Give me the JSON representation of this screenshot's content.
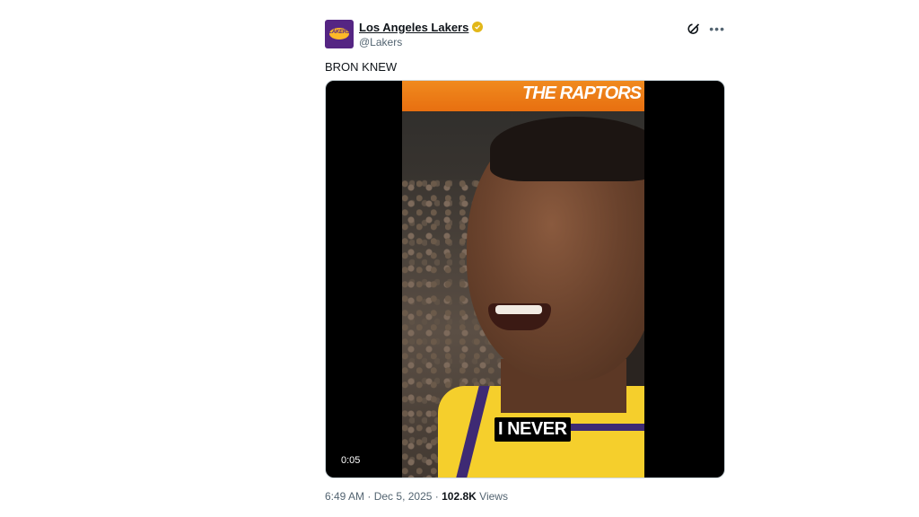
{
  "author": {
    "display_name": "Los Angeles Lakers",
    "handle": "@Lakers",
    "avatar_text": "LAKERS",
    "verified": true,
    "verified_color": "#e2b719"
  },
  "actions": {
    "grok_icon": "grok-icon",
    "more_icon": "more-icon"
  },
  "tweet": {
    "text": "BRON KNEW"
  },
  "video": {
    "banner_text": "THE RAPTORS",
    "caption": "I NEVER",
    "duration": "0:05"
  },
  "meta": {
    "time": "6:49 AM",
    "separator": "·",
    "date": "Dec 5, 2025",
    "views_count": "102.8K",
    "views_label": "Views"
  }
}
